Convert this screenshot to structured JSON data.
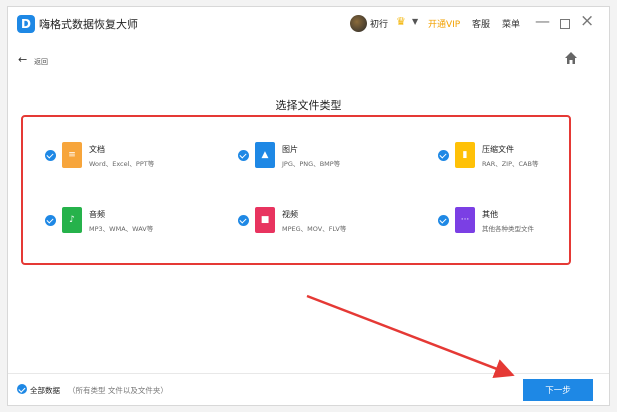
{
  "app": {
    "title": "嗨格式数据恢复大师",
    "logo": "D",
    "user_name": "初行",
    "vip_label": "开通VIP",
    "service_label": "客服",
    "menu_label": "菜单",
    "accent": "#1e88e5",
    "vip_color": "#f2a100"
  },
  "nav": {
    "back_label": "返回"
  },
  "main": {
    "title": "选择文件类型",
    "file_types": [
      {
        "name": "文档",
        "desc": "Word、Excel、PPT等",
        "color": "#f7a53b",
        "icon": "document-icon",
        "glyph": "≡",
        "checked": true
      },
      {
        "name": "图片",
        "desc": "JPG、PNG、BMP等",
        "color": "#1e88e5",
        "icon": "image-icon",
        "glyph": "▲",
        "checked": true
      },
      {
        "name": "压缩文件",
        "desc": "RAR、ZIP、CAB等",
        "color": "#ffc107",
        "icon": "archive-icon",
        "glyph": "▮",
        "checked": true
      },
      {
        "name": "音频",
        "desc": "MP3、WMA、WAV等",
        "color": "#26b24b",
        "icon": "audio-icon",
        "glyph": "♪",
        "checked": true
      },
      {
        "name": "视频",
        "desc": "MPEG、MOV、FLV等",
        "color": "#e8345f",
        "icon": "video-icon",
        "glyph": "■",
        "checked": true
      },
      {
        "name": "其他",
        "desc": "其他各种类型文件",
        "color": "#7b3fe4",
        "icon": "other-icon",
        "glyph": "···",
        "checked": true
      }
    ]
  },
  "footer": {
    "all_label": "全部数据",
    "all_desc": "（所有类型 文件以及文件夹）",
    "next_label": "下一步"
  },
  "annotation": {
    "frame_color": "#e53935",
    "arrow_color": "#e53935"
  }
}
